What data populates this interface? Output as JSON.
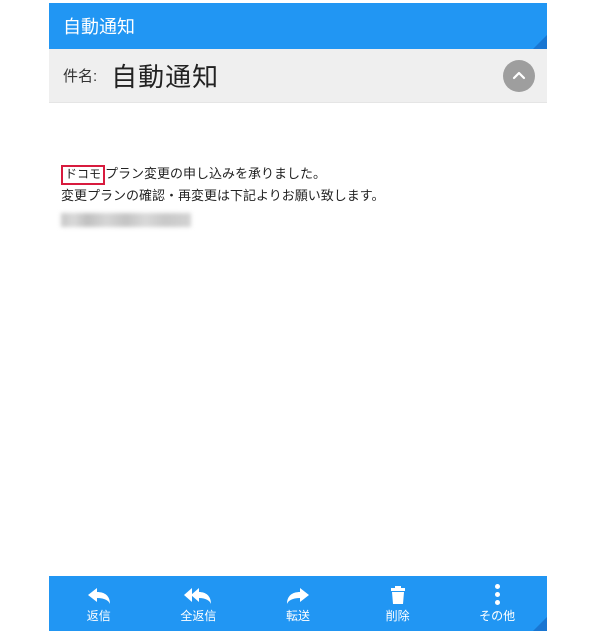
{
  "header": {
    "title": "自動通知"
  },
  "subject": {
    "label": "件名:",
    "value": "自動通知"
  },
  "body": {
    "highlighted_word": "ドコモ",
    "line1_rest": "プラン変更の申し込みを承りました。",
    "line2": "変更プランの確認・再変更は下記よりお願い致します。"
  },
  "bottombar": {
    "reply": "返信",
    "reply_all": "全返信",
    "forward": "転送",
    "delete": "削除",
    "more": "その他"
  }
}
